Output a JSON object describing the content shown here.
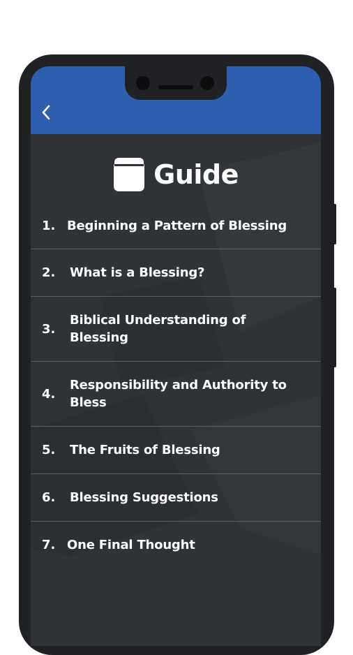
{
  "header": {
    "back_icon": "chevron-left-icon",
    "title": "Guide",
    "title_icon": "book-icon"
  },
  "colors": {
    "app_bar": "#2d5fae",
    "background": "#2f3237",
    "divider": "#5c6066",
    "text": "#ffffff"
  },
  "guide": {
    "items": [
      {
        "number": "1.",
        "label": "Beginning a Pattern of Blessing"
      },
      {
        "number": "2.",
        "label": "What is a Blessing?"
      },
      {
        "number": "3.",
        "label": "Biblical Understanding of Blessing"
      },
      {
        "number": "4.",
        "label": "Responsibility and Authority to Bless"
      },
      {
        "number": "5.",
        "label": "The Fruits of Blessing"
      },
      {
        "number": "6.",
        "label": "Blessing Suggestions"
      },
      {
        "number": "7.",
        "label": "One Final Thought"
      }
    ]
  }
}
